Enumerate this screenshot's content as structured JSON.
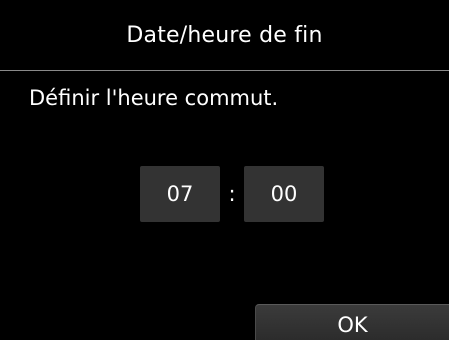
{
  "header": {
    "title": "Date/heure de fin"
  },
  "main": {
    "instruction": "Définir l'heure commut.",
    "time": {
      "hour": "07",
      "separator": ":",
      "minute": "00"
    }
  },
  "footer": {
    "ok_label": "OK"
  }
}
